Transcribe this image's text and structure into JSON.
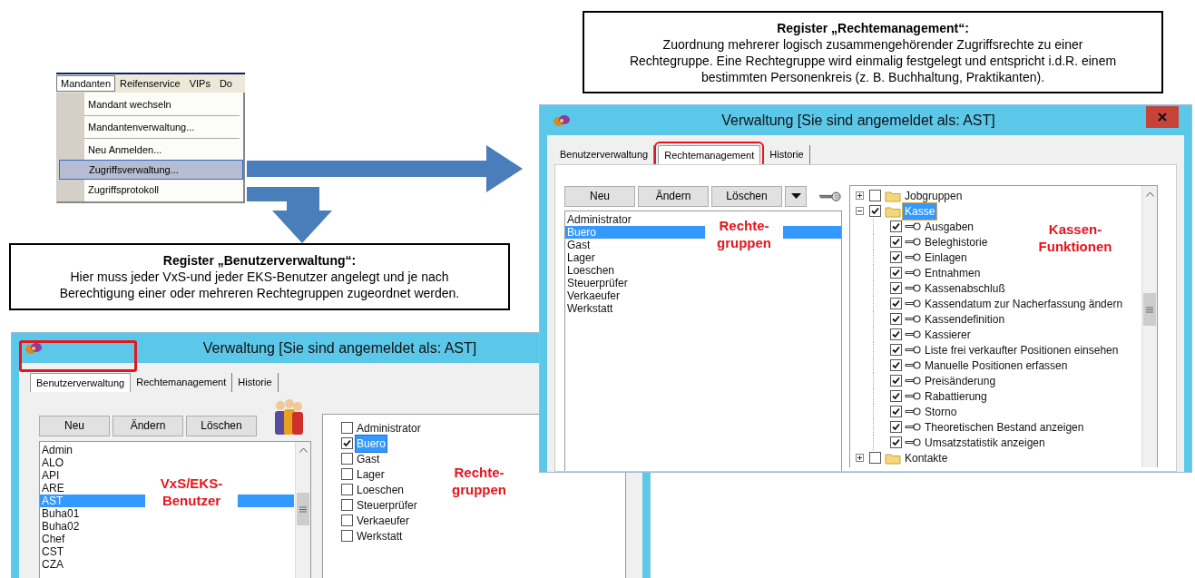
{
  "menu": {
    "menubar": [
      {
        "label": "Mandanten",
        "selected": true
      },
      {
        "label": "Reifenservice",
        "selected": false
      },
      {
        "label": "VIPs",
        "selected": false
      },
      {
        "label": "Do",
        "selected": false
      }
    ],
    "items": [
      {
        "label": "Mandant wechseln",
        "selected": false,
        "separator_after": true
      },
      {
        "label": "Mandantenverwaltung...",
        "selected": false,
        "separator_after": true
      },
      {
        "label": "Neu Anmelden...",
        "selected": false,
        "separator_after": false
      },
      {
        "label": "Zugriffsverwaltung...",
        "selected": true,
        "separator_after": false
      },
      {
        "label": "Zugriffsprotokoll",
        "selected": false,
        "separator_after": false
      }
    ]
  },
  "callouts": [
    {
      "title": "Register „Rechtemanagement“:",
      "text": "Zuordnung mehrerer logisch zusammengehörender Zugriffsrechte zu einer Rechtegruppe. Eine Rechtegruppe wird einmalig festgelegt und entspricht i.d.R. einem bestimmten Personenkreis (z. B. Buchhaltung,  Praktikanten)."
    },
    {
      "title": "Register „Benutzerverwaltung“:",
      "text": "Hier muss jeder VxS-und jeder EKS-Benutzer angelegt und je nach Berechtigung einer oder mehreren Rechtegruppen zugeordnet werden."
    }
  ],
  "rechte_window": {
    "title": "Verwaltung [Sie sind angemeldet als: AST]",
    "tabs": [
      {
        "label": "Benutzerverwaltung",
        "selected": false,
        "highlighted": false
      },
      {
        "label": "Rechtemanagement",
        "selected": true,
        "highlighted": true
      },
      {
        "label": "Historie",
        "selected": false,
        "highlighted": false
      }
    ],
    "buttons": [
      "Neu",
      "Ändern",
      "Löschen"
    ],
    "groups": [
      {
        "label": "Administrator",
        "selected": false
      },
      {
        "label": "Buero",
        "selected": true
      },
      {
        "label": "Gast",
        "selected": false
      },
      {
        "label": "Lager",
        "selected": false
      },
      {
        "label": "Loeschen",
        "selected": false
      },
      {
        "label": "Steuerprüfer",
        "selected": false
      },
      {
        "label": "Verkaeufer",
        "selected": false
      },
      {
        "label": "Werkstatt",
        "selected": false
      }
    ],
    "groups_annotation": [
      "Rechte-",
      "gruppen"
    ],
    "tree": [
      {
        "kind": "folder",
        "label": "Jobgruppen",
        "checked": false,
        "selected": false,
        "expanded": false
      },
      {
        "kind": "folder",
        "label": "Kasse",
        "checked": true,
        "selected": true,
        "expanded": true,
        "children": [
          {
            "kind": "right",
            "label": "Ausgaben",
            "checked": true,
            "selected": false
          },
          {
            "kind": "right",
            "label": "Beleghistorie",
            "checked": true,
            "selected": false
          },
          {
            "kind": "right",
            "label": "Einlagen",
            "checked": true,
            "selected": false
          },
          {
            "kind": "right",
            "label": "Entnahmen",
            "checked": true,
            "selected": false
          },
          {
            "kind": "right",
            "label": "Kassenabschluß",
            "checked": true,
            "selected": false
          },
          {
            "kind": "right",
            "label": "Kassendatum zur Nacherfassung ändern",
            "checked": true,
            "selected": false
          },
          {
            "kind": "right",
            "label": "Kassendefinition",
            "checked": true,
            "selected": false
          },
          {
            "kind": "right",
            "label": "Kassierer",
            "checked": true,
            "selected": false
          },
          {
            "kind": "right",
            "label": "Liste frei verkaufter Positionen einsehen",
            "checked": true,
            "selected": false
          },
          {
            "kind": "right",
            "label": "Manuelle Positionen erfassen",
            "checked": true,
            "selected": false
          },
          {
            "kind": "right",
            "label": "Preisänderung",
            "checked": true,
            "selected": false
          },
          {
            "kind": "right",
            "label": "Rabattierung",
            "checked": true,
            "selected": false
          },
          {
            "kind": "right",
            "label": "Storno",
            "checked": true,
            "selected": false
          },
          {
            "kind": "right",
            "label": "Theoretischen Bestand anzeigen",
            "checked": true,
            "selected": false
          },
          {
            "kind": "right",
            "label": "Umsatzstatistik anzeigen",
            "checked": true,
            "selected": false
          }
        ]
      },
      {
        "kind": "folder",
        "label": "Kontakte",
        "checked": false,
        "selected": false,
        "expanded": false
      }
    ],
    "tree_annotation": [
      "Kassen-",
      "Funktionen"
    ]
  },
  "benutzer_window": {
    "title": "Verwaltung [Sie sind angemeldet als: AST]",
    "icon_highlighted": true,
    "tabs": [
      {
        "label": "Benutzerverwaltung",
        "selected": true
      },
      {
        "label": "Rechtemanagement",
        "selected": false
      },
      {
        "label": "Historie",
        "selected": false
      }
    ],
    "buttons": [
      "Neu",
      "Ändern",
      "Löschen"
    ],
    "users": [
      {
        "label": "Admin",
        "selected": false
      },
      {
        "label": "ALO",
        "selected": false
      },
      {
        "label": "API",
        "selected": false
      },
      {
        "label": "ARE",
        "selected": false
      },
      {
        "label": "AST",
        "selected": true
      },
      {
        "label": "Buha01",
        "selected": false
      },
      {
        "label": "Buha02",
        "selected": false
      },
      {
        "label": "Chef",
        "selected": false
      },
      {
        "label": "CST",
        "selected": false
      },
      {
        "label": "CZA",
        "selected": false
      }
    ],
    "users_annotation": [
      "VxS/EKS-",
      "Benutzer"
    ],
    "groups": [
      {
        "label": "Administrator",
        "checked": false,
        "selected": false
      },
      {
        "label": "Buero",
        "checked": true,
        "selected": true
      },
      {
        "label": "Gast",
        "checked": false,
        "selected": false
      },
      {
        "label": "Lager",
        "checked": false,
        "selected": false
      },
      {
        "label": "Loeschen",
        "checked": false,
        "selected": false
      },
      {
        "label": "Steuerprüfer",
        "checked": false,
        "selected": false
      },
      {
        "label": "Verkaeufer",
        "checked": false,
        "selected": false
      },
      {
        "label": "Werkstatt",
        "checked": false,
        "selected": false
      }
    ],
    "groups_annotation": [
      "Rechte-",
      "gruppen"
    ]
  }
}
